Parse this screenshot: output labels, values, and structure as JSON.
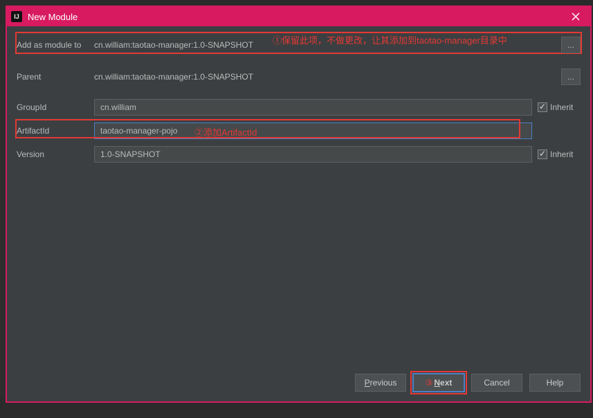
{
  "window": {
    "title": "New Module",
    "close_icon": "close"
  },
  "fields": {
    "add_as_module_label": "Add as module to",
    "add_as_module_value": "cn.william:taotao-manager:1.0-SNAPSHOT",
    "parent_label": "Parent",
    "parent_value": "cn.william:taotao-manager:1.0-SNAPSHOT",
    "groupid_label": "GroupId",
    "groupid_value": "cn.william",
    "artifactid_label": "ArtifactId",
    "artifactid_value": "taotao-manager-pojo",
    "version_label": "Version",
    "version_value": "1.0-SNAPSHOT",
    "inherit_label": "Inherit",
    "browse_btn": "..."
  },
  "buttons": {
    "previous": "Previous",
    "next": "Next",
    "cancel": "Cancel",
    "help": "Help"
  },
  "callouts": {
    "c1": "①保留此项，不做更改，让其添加到taotao-manager目录中",
    "c2": "②添加ArtifactId",
    "c3": "③"
  }
}
